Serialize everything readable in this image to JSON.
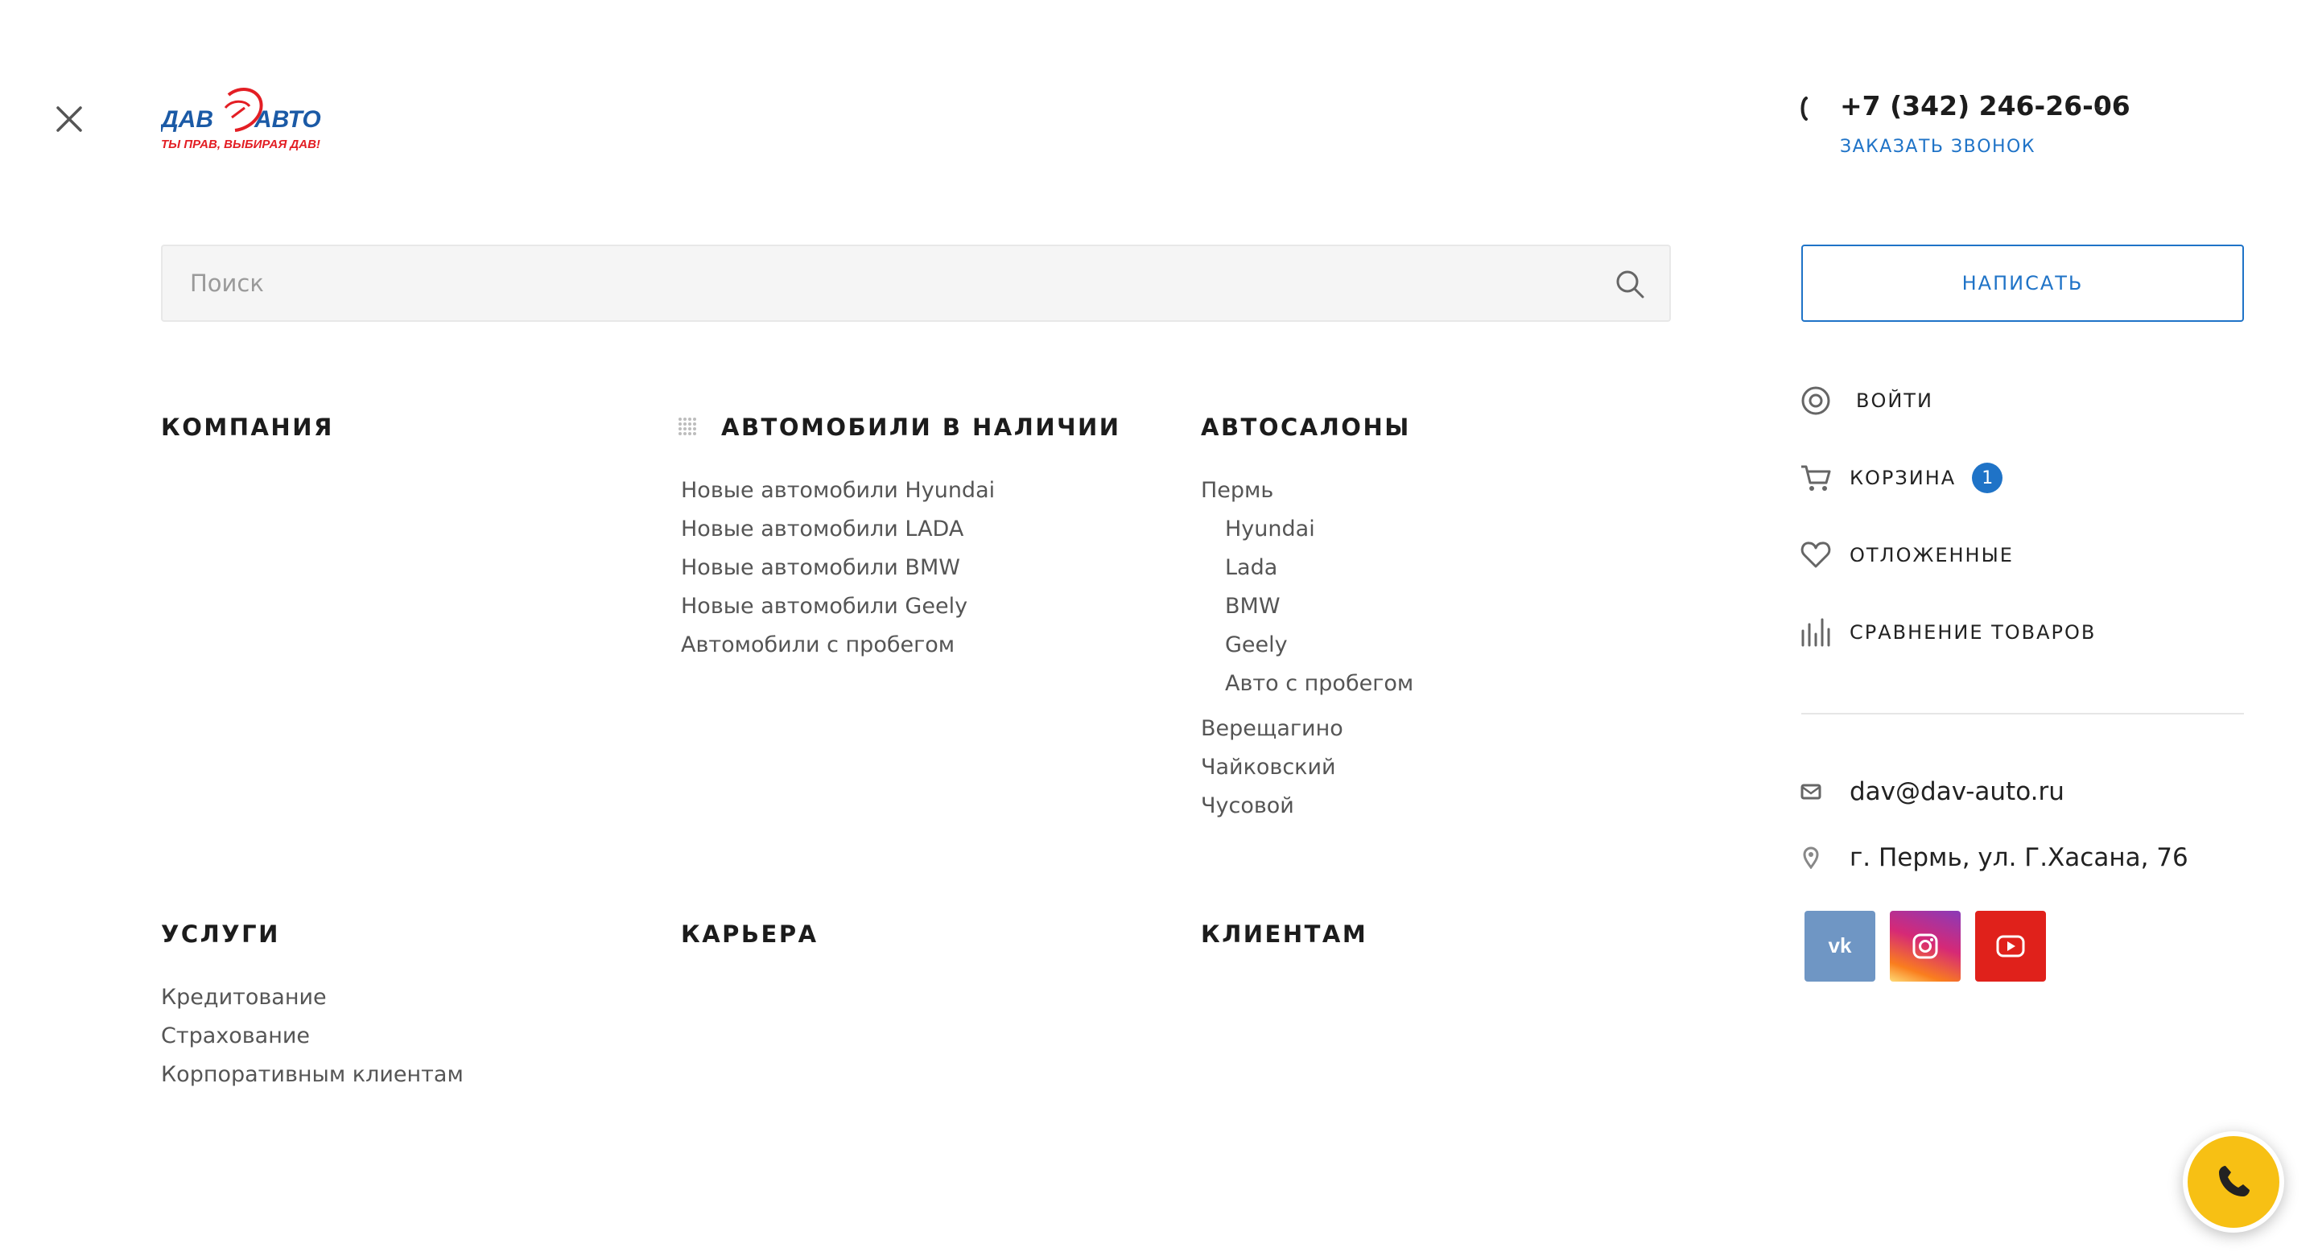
{
  "logo": {
    "brand_left": "ДАВ",
    "brand_right": "АВТО",
    "slogan": "ТЫ ПРАВ, ВЫБИРАЯ ДАВ!"
  },
  "header": {
    "phone": "+7 (342) 246-26-06",
    "callback_label": "ЗАКАЗАТЬ ЗВОНОК"
  },
  "search": {
    "placeholder": "Поиск"
  },
  "write_button": "НАПИСАТЬ",
  "menu": {
    "company": {
      "title": "КОМПАНИЯ"
    },
    "cars": {
      "title": "АВТОМОБИЛИ В НАЛИЧИИ",
      "items": [
        "Новые автомобили Hyundai",
        "Новые автомобили LADA",
        "Новые автомобили BMW",
        "Новые автомобили Geely",
        "Автомобили с пробегом"
      ]
    },
    "showrooms": {
      "title": "АВТОСАЛОНЫ",
      "perm": "Пермь",
      "perm_sub": [
        "Hyundai",
        "Lada",
        "BMW",
        "Geely",
        "Авто с пробегом"
      ],
      "others": [
        "Верещагино",
        "Чайковский",
        "Чусовой"
      ]
    },
    "services": {
      "title": "УСЛУГИ",
      "items": [
        "Кредитование",
        "Страхование",
        "Корпоративным клиентам"
      ]
    },
    "career": {
      "title": "КАРЬЕРА"
    },
    "clients": {
      "title": "КЛИЕНТАМ"
    }
  },
  "sidebar": {
    "login": "ВОЙТИ",
    "cart": "КОРЗИНА",
    "cart_count": "1",
    "wishlist": "ОТЛОЖЕННЫЕ",
    "compare": "СРАВНЕНИЕ ТОВАРОВ",
    "email": "dav@dav-auto.ru",
    "address": "г. Пермь, ул. Г.Хасана, 76"
  },
  "social": {
    "vk": "vk-icon",
    "instagram": "instagram-icon",
    "youtube": "youtube-icon"
  },
  "colors": {
    "accent": "#1f73c7",
    "fab": "#f7c014",
    "logo_red": "#e31e24",
    "logo_blue": "#1b5aa6"
  }
}
